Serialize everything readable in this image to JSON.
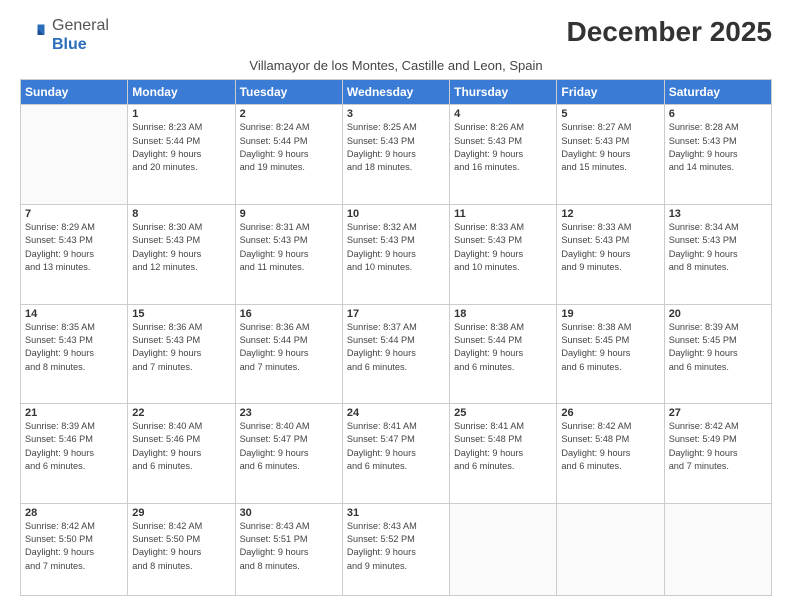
{
  "logo": {
    "general": "General",
    "blue": "Blue"
  },
  "header": {
    "month": "December 2025",
    "location": "Villamayor de los Montes, Castille and Leon, Spain"
  },
  "weekdays": [
    "Sunday",
    "Monday",
    "Tuesday",
    "Wednesday",
    "Thursday",
    "Friday",
    "Saturday"
  ],
  "weeks": [
    [
      {
        "day": "",
        "info": ""
      },
      {
        "day": "1",
        "info": "Sunrise: 8:23 AM\nSunset: 5:44 PM\nDaylight: 9 hours\nand 20 minutes."
      },
      {
        "day": "2",
        "info": "Sunrise: 8:24 AM\nSunset: 5:44 PM\nDaylight: 9 hours\nand 19 minutes."
      },
      {
        "day": "3",
        "info": "Sunrise: 8:25 AM\nSunset: 5:43 PM\nDaylight: 9 hours\nand 18 minutes."
      },
      {
        "day": "4",
        "info": "Sunrise: 8:26 AM\nSunset: 5:43 PM\nDaylight: 9 hours\nand 16 minutes."
      },
      {
        "day": "5",
        "info": "Sunrise: 8:27 AM\nSunset: 5:43 PM\nDaylight: 9 hours\nand 15 minutes."
      },
      {
        "day": "6",
        "info": "Sunrise: 8:28 AM\nSunset: 5:43 PM\nDaylight: 9 hours\nand 14 minutes."
      }
    ],
    [
      {
        "day": "7",
        "info": "Sunrise: 8:29 AM\nSunset: 5:43 PM\nDaylight: 9 hours\nand 13 minutes."
      },
      {
        "day": "8",
        "info": "Sunrise: 8:30 AM\nSunset: 5:43 PM\nDaylight: 9 hours\nand 12 minutes."
      },
      {
        "day": "9",
        "info": "Sunrise: 8:31 AM\nSunset: 5:43 PM\nDaylight: 9 hours\nand 11 minutes."
      },
      {
        "day": "10",
        "info": "Sunrise: 8:32 AM\nSunset: 5:43 PM\nDaylight: 9 hours\nand 10 minutes."
      },
      {
        "day": "11",
        "info": "Sunrise: 8:33 AM\nSunset: 5:43 PM\nDaylight: 9 hours\nand 10 minutes."
      },
      {
        "day": "12",
        "info": "Sunrise: 8:33 AM\nSunset: 5:43 PM\nDaylight: 9 hours\nand 9 minutes."
      },
      {
        "day": "13",
        "info": "Sunrise: 8:34 AM\nSunset: 5:43 PM\nDaylight: 9 hours\nand 8 minutes."
      }
    ],
    [
      {
        "day": "14",
        "info": "Sunrise: 8:35 AM\nSunset: 5:43 PM\nDaylight: 9 hours\nand 8 minutes."
      },
      {
        "day": "15",
        "info": "Sunrise: 8:36 AM\nSunset: 5:43 PM\nDaylight: 9 hours\nand 7 minutes."
      },
      {
        "day": "16",
        "info": "Sunrise: 8:36 AM\nSunset: 5:44 PM\nDaylight: 9 hours\nand 7 minutes."
      },
      {
        "day": "17",
        "info": "Sunrise: 8:37 AM\nSunset: 5:44 PM\nDaylight: 9 hours\nand 6 minutes."
      },
      {
        "day": "18",
        "info": "Sunrise: 8:38 AM\nSunset: 5:44 PM\nDaylight: 9 hours\nand 6 minutes."
      },
      {
        "day": "19",
        "info": "Sunrise: 8:38 AM\nSunset: 5:45 PM\nDaylight: 9 hours\nand 6 minutes."
      },
      {
        "day": "20",
        "info": "Sunrise: 8:39 AM\nSunset: 5:45 PM\nDaylight: 9 hours\nand 6 minutes."
      }
    ],
    [
      {
        "day": "21",
        "info": "Sunrise: 8:39 AM\nSunset: 5:46 PM\nDaylight: 9 hours\nand 6 minutes."
      },
      {
        "day": "22",
        "info": "Sunrise: 8:40 AM\nSunset: 5:46 PM\nDaylight: 9 hours\nand 6 minutes."
      },
      {
        "day": "23",
        "info": "Sunrise: 8:40 AM\nSunset: 5:47 PM\nDaylight: 9 hours\nand 6 minutes."
      },
      {
        "day": "24",
        "info": "Sunrise: 8:41 AM\nSunset: 5:47 PM\nDaylight: 9 hours\nand 6 minutes."
      },
      {
        "day": "25",
        "info": "Sunrise: 8:41 AM\nSunset: 5:48 PM\nDaylight: 9 hours\nand 6 minutes."
      },
      {
        "day": "26",
        "info": "Sunrise: 8:42 AM\nSunset: 5:48 PM\nDaylight: 9 hours\nand 6 minutes."
      },
      {
        "day": "27",
        "info": "Sunrise: 8:42 AM\nSunset: 5:49 PM\nDaylight: 9 hours\nand 7 minutes."
      }
    ],
    [
      {
        "day": "28",
        "info": "Sunrise: 8:42 AM\nSunset: 5:50 PM\nDaylight: 9 hours\nand 7 minutes."
      },
      {
        "day": "29",
        "info": "Sunrise: 8:42 AM\nSunset: 5:50 PM\nDaylight: 9 hours\nand 8 minutes."
      },
      {
        "day": "30",
        "info": "Sunrise: 8:43 AM\nSunset: 5:51 PM\nDaylight: 9 hours\nand 8 minutes."
      },
      {
        "day": "31",
        "info": "Sunrise: 8:43 AM\nSunset: 5:52 PM\nDaylight: 9 hours\nand 9 minutes."
      },
      {
        "day": "",
        "info": ""
      },
      {
        "day": "",
        "info": ""
      },
      {
        "day": "",
        "info": ""
      }
    ]
  ]
}
